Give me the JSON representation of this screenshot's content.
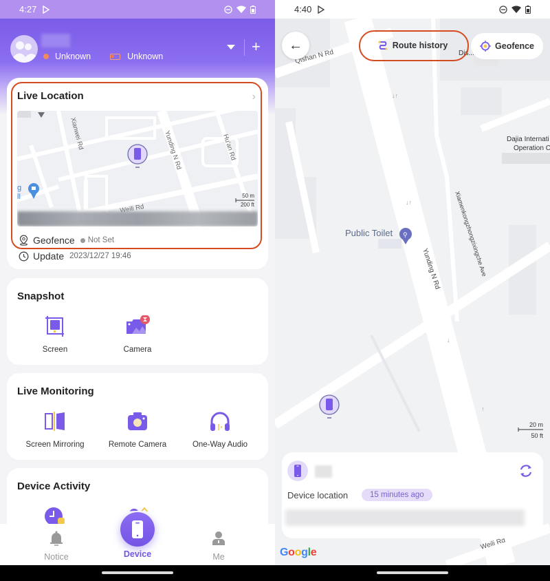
{
  "left_screen": {
    "status_bar": {
      "time": "4:27"
    },
    "header": {
      "connection_status": "Unknown",
      "battery_status": "Unknown",
      "dropdown_icon": "triangle-down-icon",
      "add_icon": "plus-icon"
    },
    "live_location": {
      "title": "Live Location",
      "map_labels": [
        "Xianwei Rd",
        "Yunding N Rd",
        "Hu'an Rd",
        "Weili Rd",
        "g",
        "ll"
      ],
      "scale_top": "50 m",
      "scale_bottom": "200 ft",
      "geofence_label": "Geofence",
      "geofence_status": "Not Set",
      "update_label": "Update",
      "update_time": "2023/12/27 19:46"
    },
    "snapshot": {
      "title": "Snapshot",
      "items": [
        {
          "label": "Screen",
          "icon": "screen-capture-icon"
        },
        {
          "label": "Camera",
          "icon": "camera-photo-icon"
        }
      ]
    },
    "live_monitoring": {
      "title": "Live Monitoring",
      "items": [
        {
          "label": "Screen Mirroring",
          "icon": "screen-mirror-icon"
        },
        {
          "label": "Remote Camera",
          "icon": "remote-camera-icon"
        },
        {
          "label": "One-Way Audio",
          "icon": "headphones-icon"
        }
      ]
    },
    "device_activity": {
      "title": "Device Activity"
    },
    "bottom_nav": {
      "items": [
        {
          "label": "Notice",
          "icon": "bell-icon"
        },
        {
          "label": "Device",
          "icon": "phone-icon",
          "active": true
        },
        {
          "label": "Me",
          "icon": "person-icon"
        }
      ]
    },
    "colors": {
      "accent": "#7356e0",
      "highlight": "#d64a1f",
      "header": "#7b5ce8"
    }
  },
  "right_screen": {
    "status_bar": {
      "time": "4:40"
    },
    "toolbar": {
      "back_icon": "arrow-left-icon",
      "route_history_label": "Route history",
      "geofence_label": "Geofence"
    },
    "map_labels": {
      "qishan": "Qishan N Rd",
      "dis": "Dis...",
      "dajia_line1": "Dajia Internati",
      "dajia_line2": "Operation C",
      "public_toilet": "Public Toilet",
      "yunding": "Yunding N Rd",
      "xiamen": "Xiamenkongzhongzixingche Ave",
      "weili": "Weili Rd"
    },
    "scale_top": "20 m",
    "scale_bottom": "50 ft",
    "location_card": {
      "label": "Device location",
      "badge": "15 minutes ago"
    },
    "google_logo": "Google"
  }
}
